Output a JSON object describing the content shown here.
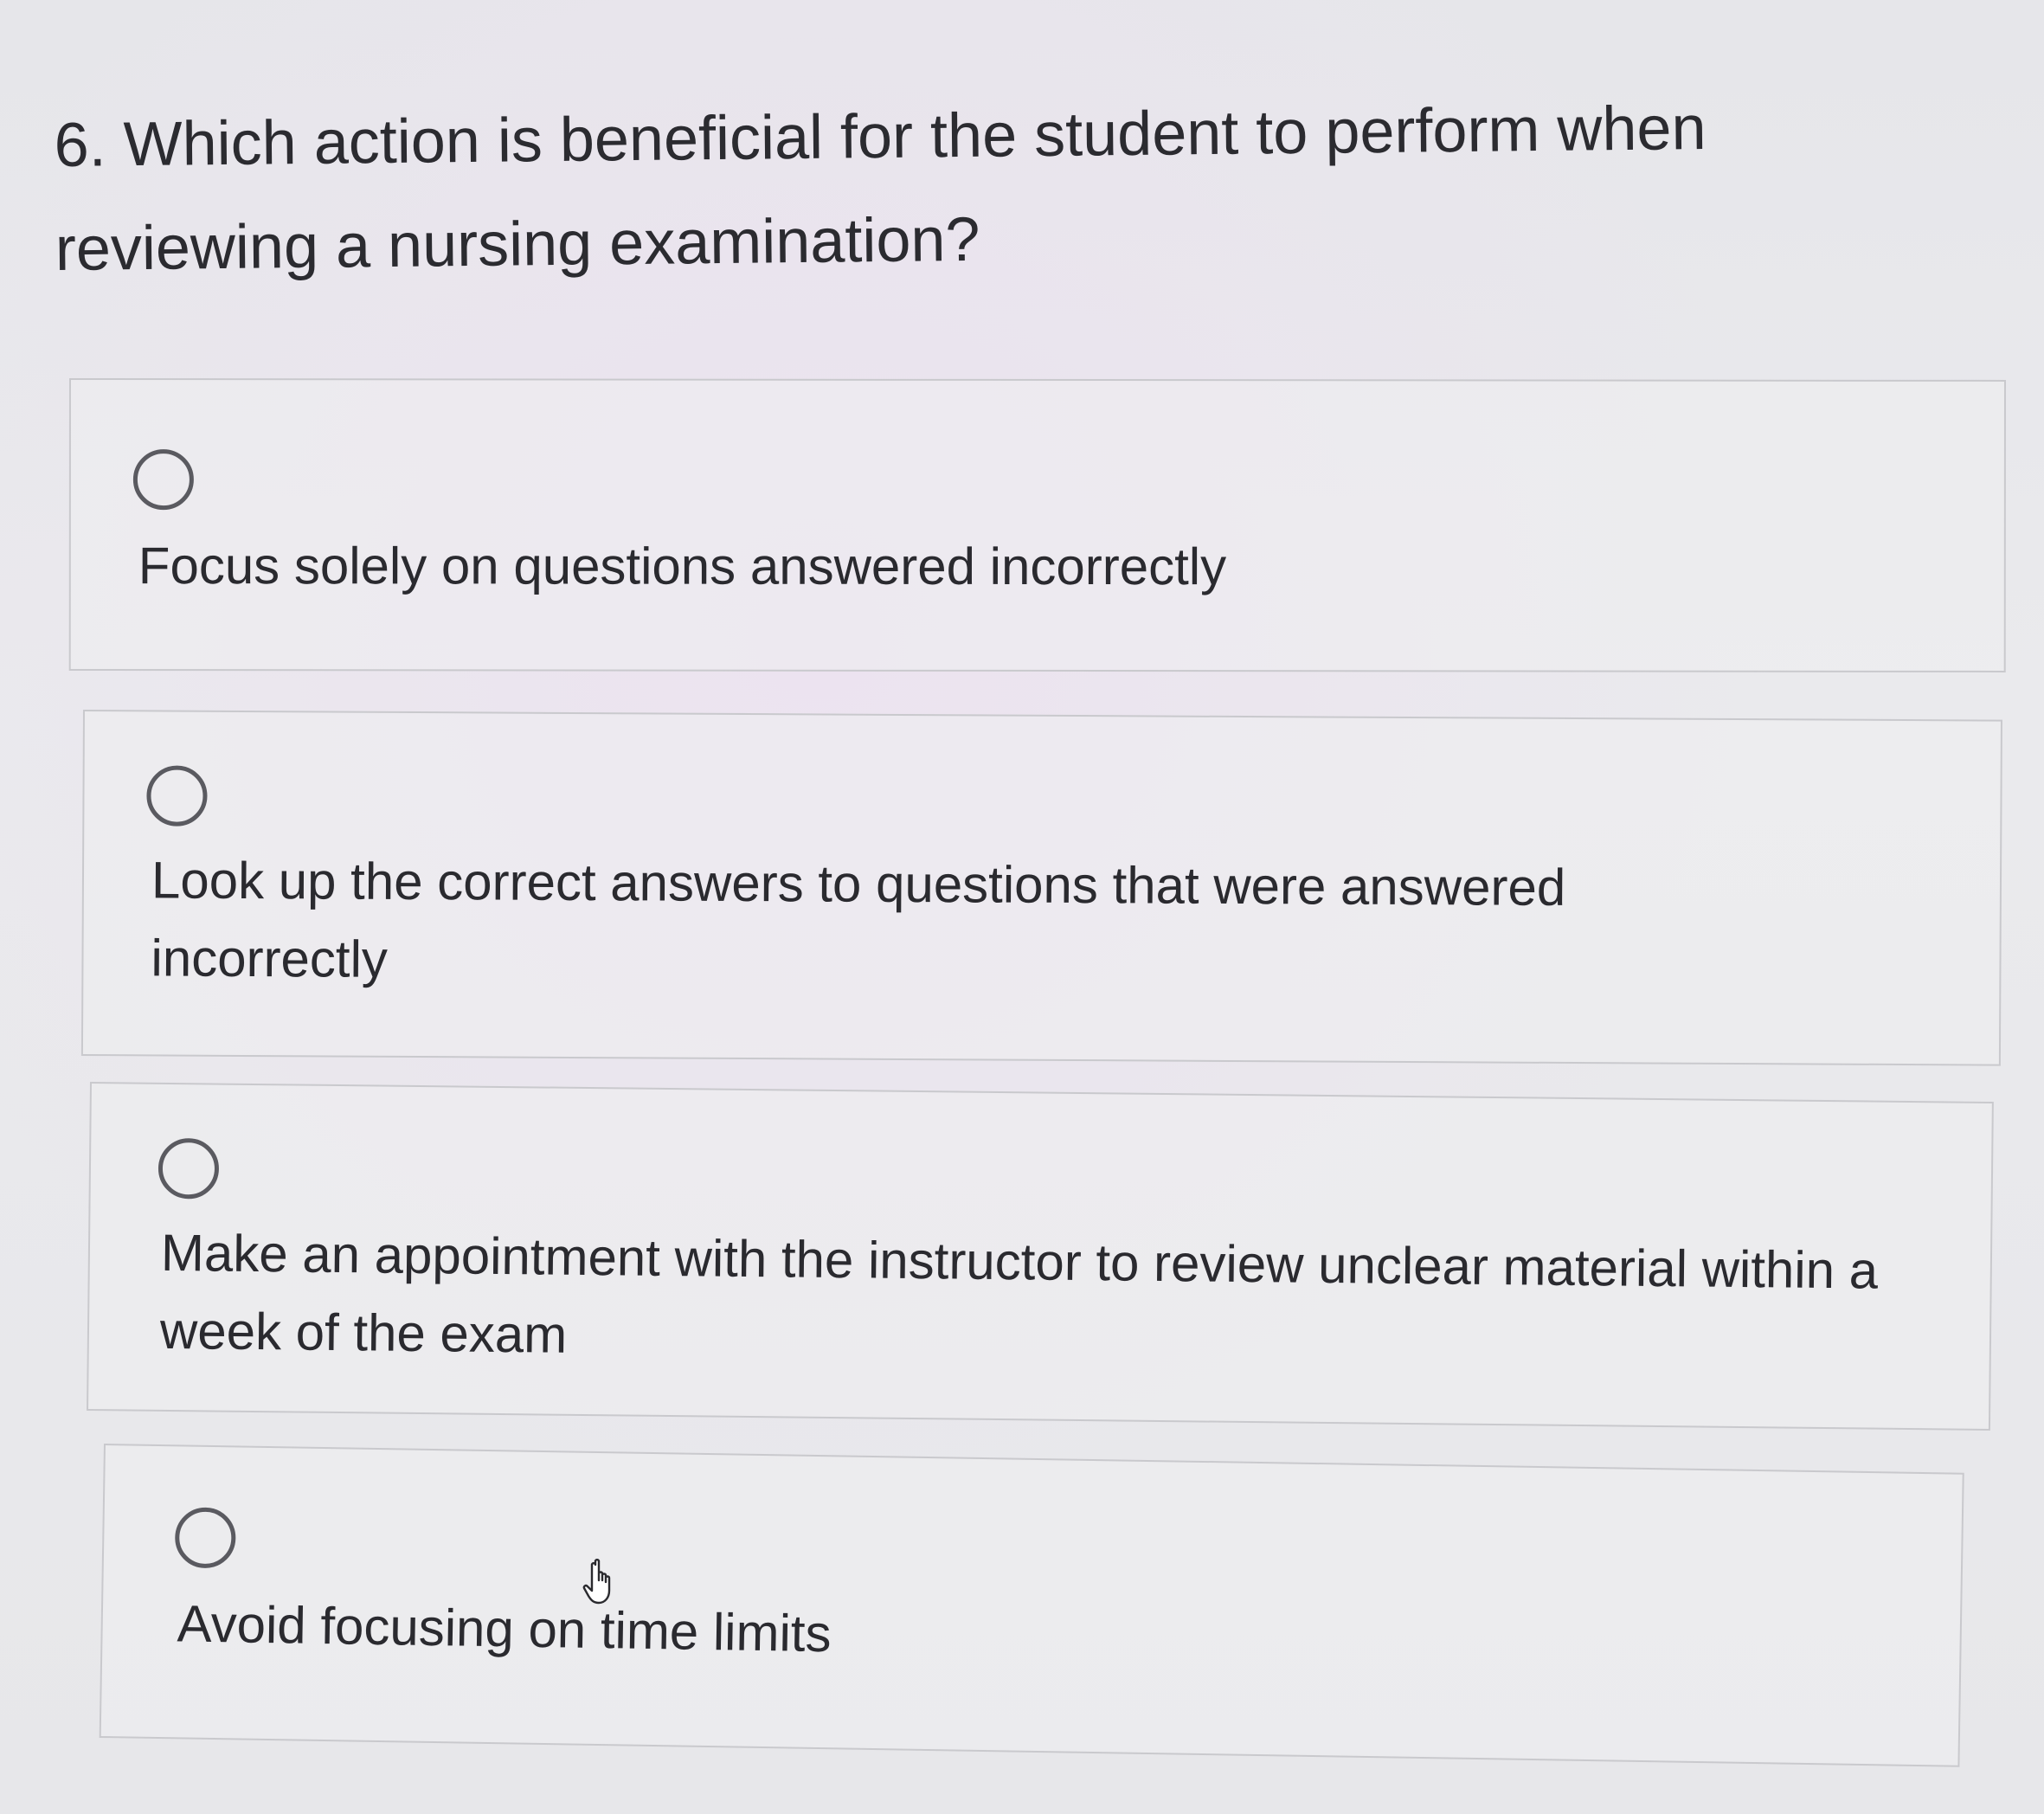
{
  "question": {
    "text": "6. Which action is beneficial for the student to perform when reviewing a nursing examination?"
  },
  "options": [
    {
      "label": "Focus solely on questions answered incorrectly",
      "selected": false
    },
    {
      "label": "Look up the correct answers to questions that were answered incorrectly",
      "selected": false
    },
    {
      "label": "Make an appointment with the instructor to review unclear material within a week of the exam",
      "selected": false
    },
    {
      "label": "Avoid focusing on time limits",
      "selected": false
    }
  ],
  "cursor": {
    "icon": "hand-pointer-icon"
  }
}
